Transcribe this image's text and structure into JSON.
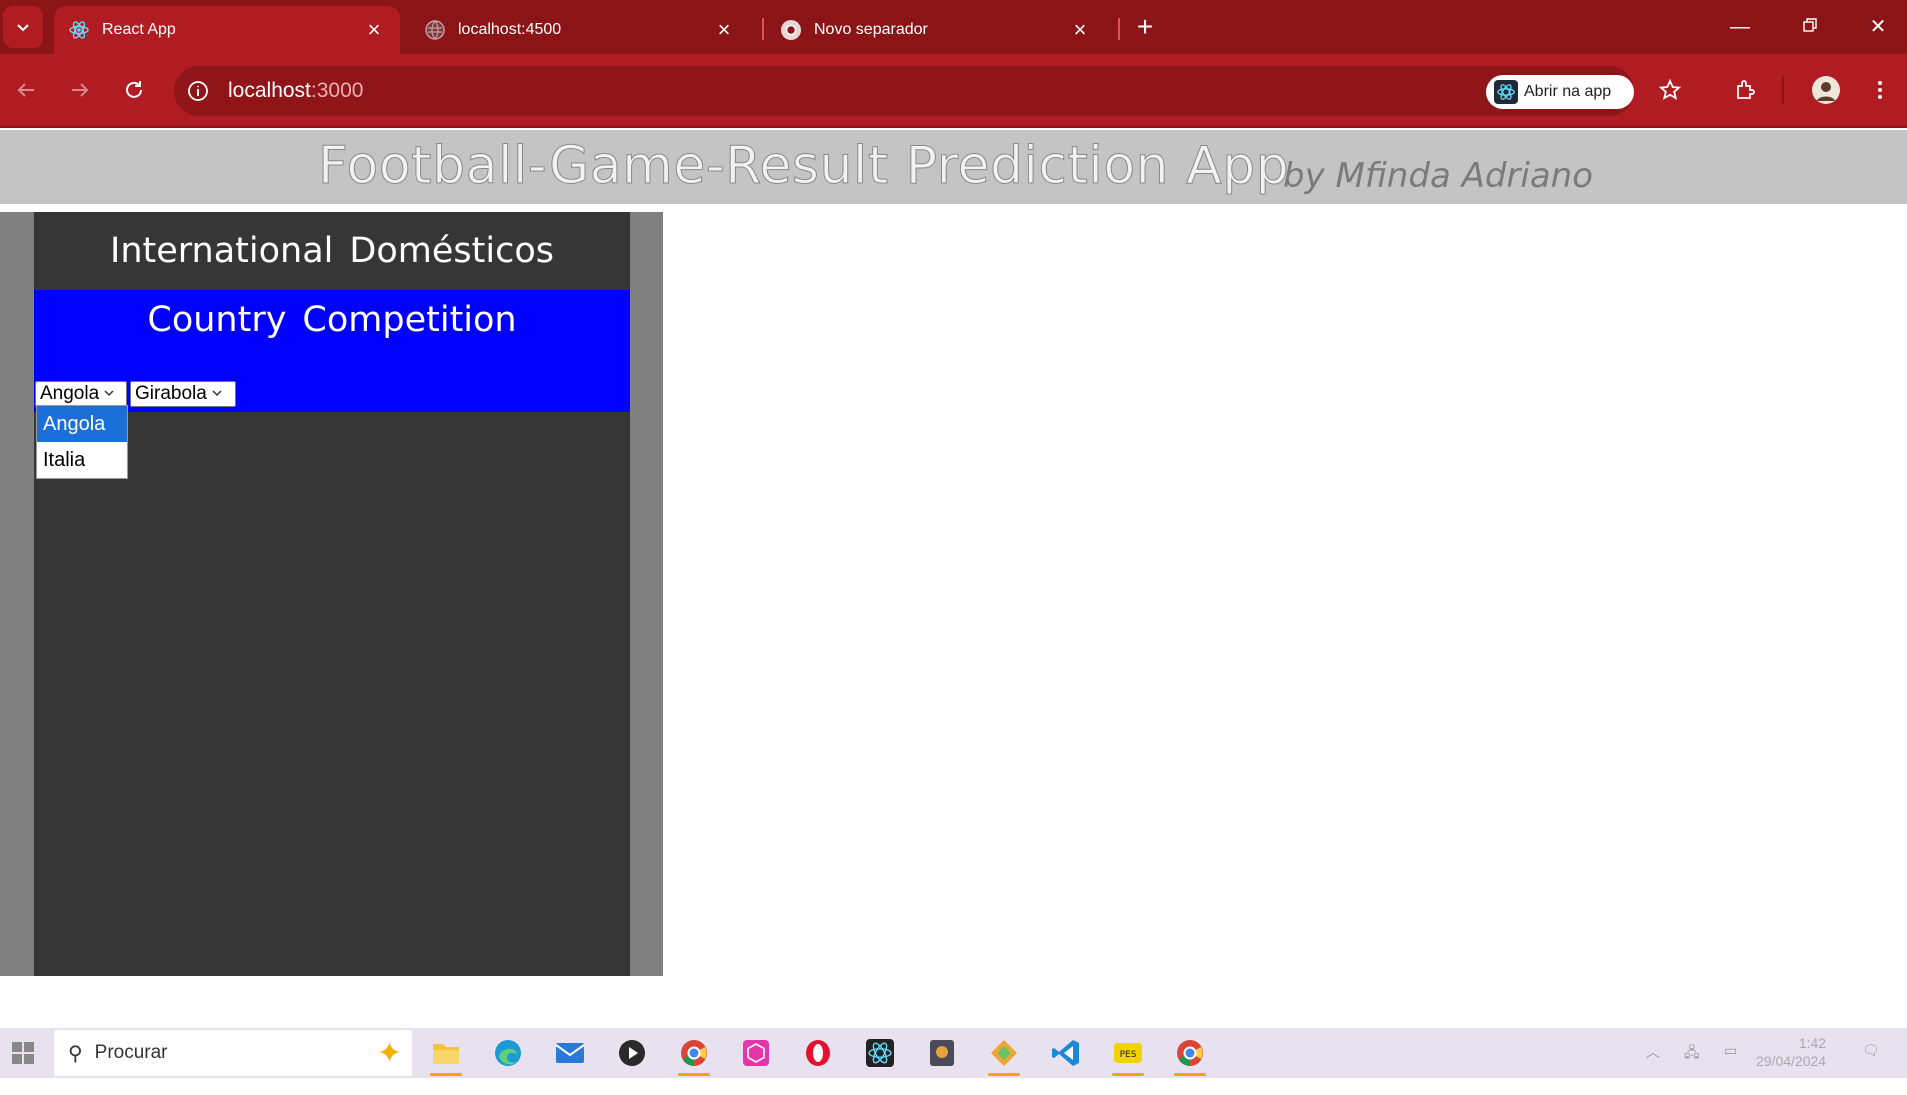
{
  "browser": {
    "tabs": [
      {
        "title": "React App",
        "active": true
      },
      {
        "title": "localhost:4500",
        "active": false
      },
      {
        "title": "Novo separador",
        "active": false
      }
    ],
    "url_host": "localhost",
    "url_port": ":3000",
    "open_app_label": "Abrir na app",
    "theme_color": "#b01c22"
  },
  "app": {
    "title": "Football-Game-Result Prediction App",
    "author": "by Mfinda Adriano",
    "top_tabs": [
      "International",
      "Domésticos"
    ],
    "blue_headers": [
      "Country",
      "Competition"
    ],
    "country_select": {
      "value": "Angola",
      "options": [
        "Angola",
        "Italia"
      ],
      "highlighted": "Angola"
    },
    "competition_select": {
      "value": "Girabola"
    },
    "accent_blue": "#0000ff"
  },
  "taskbar": {
    "search_placeholder": "Procurar",
    "clock_time": "1:42",
    "clock_date": "29/04/2024"
  }
}
